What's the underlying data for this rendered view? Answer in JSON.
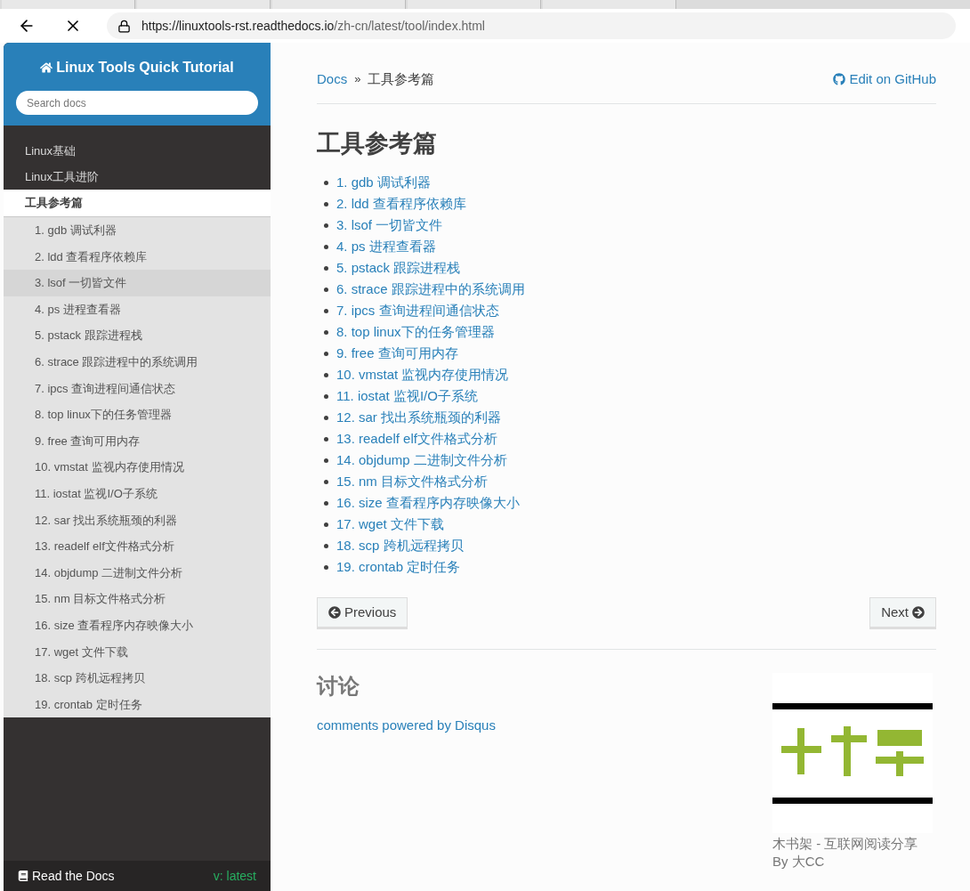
{
  "browser": {
    "url_host": "https://linuxtools-rst.readthedocs.io",
    "url_path": "/zh-cn/latest/tool/index.html"
  },
  "sidebar": {
    "title": "Linux Tools Quick Tutorial",
    "search": {
      "placeholder": "Search docs"
    },
    "items": [
      {
        "label": "Linux基础",
        "current": false
      },
      {
        "label": "Linux工具进阶",
        "current": false
      },
      {
        "label": "工具参考篇",
        "current": true,
        "children": [
          {
            "label": "1. gdb 调试利器",
            "selected": false
          },
          {
            "label": "2. ldd 查看程序依赖库",
            "selected": false
          },
          {
            "label": "3. lsof 一切皆文件",
            "selected": true
          },
          {
            "label": "4. ps 进程查看器",
            "selected": false
          },
          {
            "label": "5. pstack 跟踪进程栈",
            "selected": false
          },
          {
            "label": "6. strace 跟踪进程中的系统调用",
            "selected": false
          },
          {
            "label": "7. ipcs 查询进程间通信状态",
            "selected": false
          },
          {
            "label": "8. top linux下的任务管理器",
            "selected": false
          },
          {
            "label": "9. free 查询可用内存",
            "selected": false
          },
          {
            "label": "10. vmstat 监视内存使用情况",
            "selected": false
          },
          {
            "label": "11. iostat 监视I/O子系统",
            "selected": false
          },
          {
            "label": "12. sar 找出系统瓶颈的利器",
            "selected": false
          },
          {
            "label": "13. readelf elf文件格式分析",
            "selected": false
          },
          {
            "label": "14. objdump 二进制文件分析",
            "selected": false
          },
          {
            "label": "15. nm 目标文件格式分析",
            "selected": false
          },
          {
            "label": "16. size 查看程序内存映像大小",
            "selected": false
          },
          {
            "label": "17. wget 文件下载",
            "selected": false
          },
          {
            "label": "18. scp 跨机远程拷贝",
            "selected": false
          },
          {
            "label": "19. crontab 定时任务",
            "selected": false
          }
        ]
      }
    ],
    "footer": {
      "label": "Read the Docs",
      "version": "v: latest"
    }
  },
  "content": {
    "breadcrumb": {
      "root": "Docs",
      "separator": "»",
      "current": "工具参考篇"
    },
    "edit_link": "Edit on GitHub",
    "title": "工具参考篇",
    "toc": [
      "1. gdb 调试利器",
      "2. ldd 查看程序依赖库",
      "3. lsof 一切皆文件",
      "4. ps 进程查看器",
      "5. pstack 跟踪进程栈",
      "6. strace 跟踪进程中的系统调用",
      "7. ipcs 查询进程间通信状态",
      "8. top linux下的任务管理器",
      "9. free 查询可用内存",
      "10. vmstat 监视内存使用情况",
      "11. iostat 监视I/O子系统",
      "12. sar 找出系统瓶颈的利器",
      "13. readelf elf文件格式分析",
      "14. objdump 二进制文件分析",
      "15. nm 目标文件格式分析",
      "16. size 查看程序内存映像大小",
      "17. wget 文件下载",
      "18. scp 跨机远程拷贝",
      "19. crontab 定时任务"
    ],
    "previous": "Previous",
    "next": "Next",
    "discussion_title": "讨论",
    "disqus_link": "comments powered by Disqus",
    "promo": {
      "kind": "picture",
      "caption": "木书架 - 互联网阅读分享",
      "author": "By 大CC"
    }
  }
}
